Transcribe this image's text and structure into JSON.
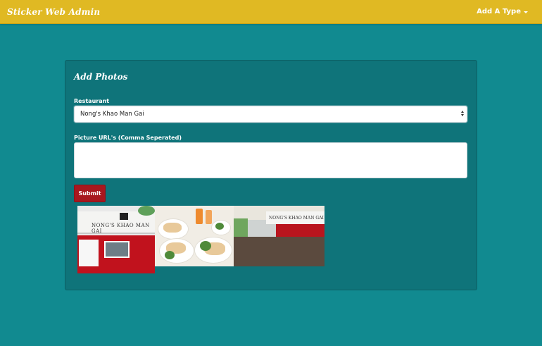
{
  "navbar": {
    "brand": "Sticker Web Admin",
    "dropdown_label": "Add A Type"
  },
  "form": {
    "title": "Add Photos",
    "restaurant_label": "Restaurant",
    "restaurant_selected": "Nong's Khao Man Gai",
    "urls_label": "Picture URL's (Comma Seperated)",
    "urls_value": "",
    "submit_label": "Submit"
  },
  "photos": [
    {
      "subject": "food-truck-photo",
      "sign_text": "NONG'S KHAO MAN GAI"
    },
    {
      "subject": "food-plates-photo"
    },
    {
      "subject": "food-cart-crowd-photo",
      "sign_text": "NONG'S KHAO MAN GAI"
    }
  ]
}
